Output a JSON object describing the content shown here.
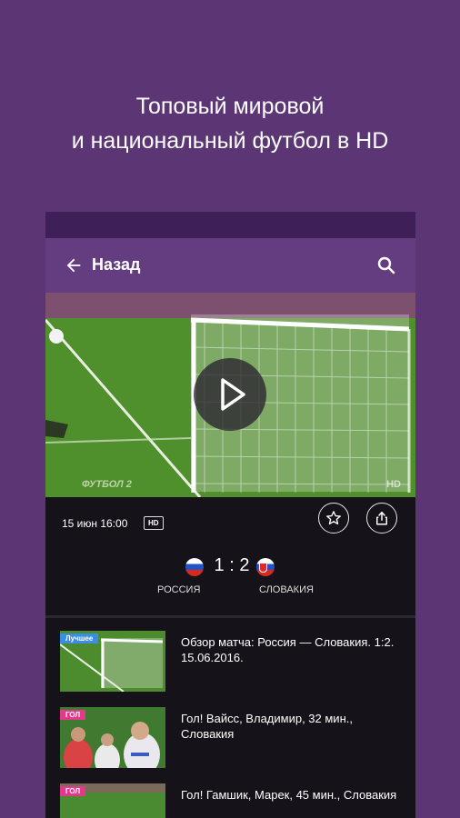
{
  "headline": {
    "line1": "Топовый мировой",
    "line2": "и национальный футбол в HD"
  },
  "appbar": {
    "back_label": "Назад"
  },
  "video": {
    "channel_logo": "ФУТБОЛ 2",
    "watermark": "HD"
  },
  "match": {
    "date": "15 июн 16:00",
    "quality_badge": "HD",
    "score": "1 : 2",
    "team_home": "РОССИЯ",
    "team_away": "СЛОВАКИЯ"
  },
  "list": [
    {
      "badge": "Лучшее",
      "badge_color": "#3a8ee6",
      "title": "Обзор матча: Россия — Словакия. 1:2. 15.06.2016."
    },
    {
      "badge": "ГОЛ",
      "badge_color": "#e23a8b",
      "title": "Гол! Вайсс, Владимир, 32 мин., Словакия"
    },
    {
      "badge": "ГОЛ",
      "badge_color": "#e23a8b",
      "title": "Гол! Гамшик, Марек, 45 мин., Словакия"
    }
  ],
  "colors": {
    "background": "#5b3574",
    "appbar": "#643d80",
    "statusbar": "#3f1f58",
    "screen": "#151219"
  }
}
